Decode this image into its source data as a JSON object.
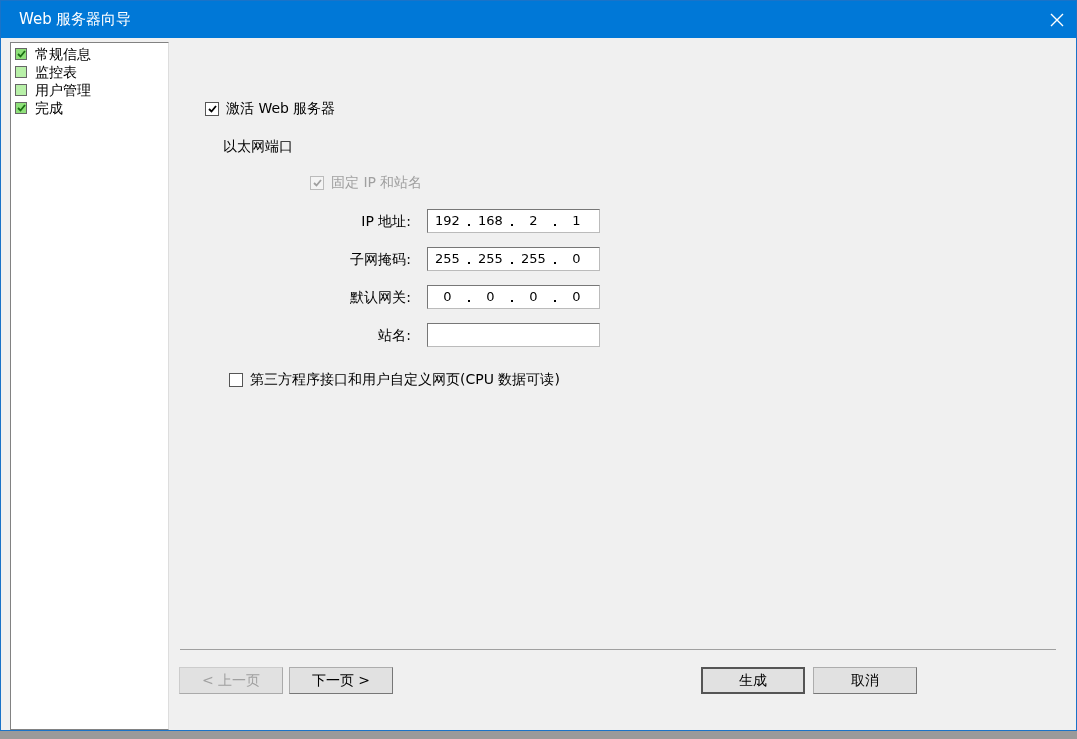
{
  "window": {
    "title": "Web 服务器向导"
  },
  "sidebar": {
    "items": [
      {
        "label": "常规信息",
        "checked": true
      },
      {
        "label": "监控表",
        "checked": false
      },
      {
        "label": "用户管理",
        "checked": false
      },
      {
        "label": "完成",
        "checked": true
      }
    ]
  },
  "form": {
    "activate": {
      "label": "激活 Web 服务器",
      "checked": true,
      "disabled": false
    },
    "ethernet_label": "以太网端口",
    "fixed_ip": {
      "label": "固定 IP 和站名",
      "checked": true,
      "disabled": true
    },
    "fields": [
      {
        "label": "IP 地址:",
        "octets": [
          "192",
          "168",
          "2",
          "1"
        ]
      },
      {
        "label": "子网掩码:",
        "octets": [
          "255",
          "255",
          "255",
          "0"
        ]
      },
      {
        "label": "默认网关:",
        "octets": [
          "0",
          "0",
          "0",
          "0"
        ]
      },
      {
        "label": "站名:"
      }
    ],
    "third_party": {
      "label": "第三方程序接口和用户自定义网页(CPU 数据可读)",
      "checked": false,
      "disabled": false
    }
  },
  "nav_buttons": [
    {
      "label": "< 上一页",
      "disabled": true,
      "default": false
    },
    {
      "label": "下一页 >",
      "disabled": false,
      "default": false
    }
  ],
  "action_buttons": [
    {
      "label": "生成",
      "disabled": false,
      "default": true
    },
    {
      "label": "取消",
      "disabled": false,
      "default": false
    }
  ]
}
